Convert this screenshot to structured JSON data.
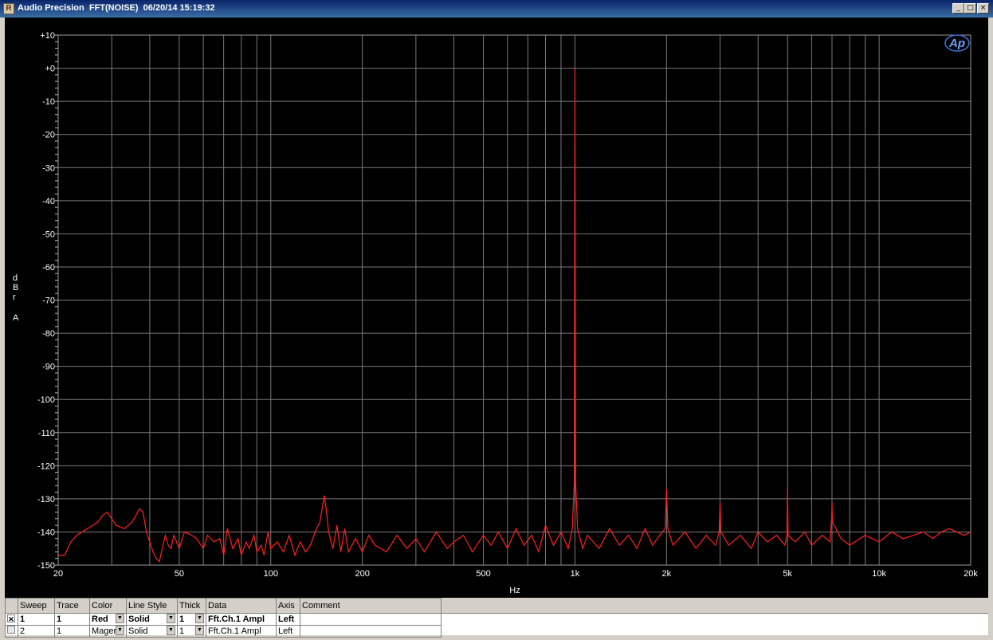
{
  "window": {
    "title": "Audio Precision  FFT(NOISE)  06/20/14 15:19:32",
    "icon": "ap-app-icon",
    "buttons": [
      "_",
      "□",
      "×"
    ]
  },
  "logo_text": "Ap",
  "chart_data": {
    "type": "line",
    "x_scale": "log",
    "xlim": [
      20,
      20000
    ],
    "ylim": [
      -150,
      10
    ],
    "xlabel": "Hz",
    "ylabel": "dBr A",
    "grid": true,
    "x_tick_labels": [
      "20",
      "50",
      "100",
      "200",
      "500",
      "1k",
      "2k",
      "5k",
      "10k",
      "20k"
    ],
    "x_ticks": [
      20,
      50,
      100,
      200,
      500,
      1000,
      2000,
      5000,
      10000,
      20000
    ],
    "y_ticks": [
      10,
      0,
      -10,
      -20,
      -30,
      -40,
      -50,
      -60,
      -70,
      -80,
      -90,
      -100,
      -110,
      -120,
      -130,
      -140,
      -150
    ],
    "y_tick_labels": [
      "+10",
      "+0",
      "-10",
      "-20",
      "-30",
      "-40",
      "-50",
      "-60",
      "-70",
      "-80",
      "-90",
      "-100",
      "-110",
      "-120",
      "-130",
      "-140",
      "-150"
    ],
    "background": "#000000",
    "grid_color": "#7a7a7a",
    "series": [
      {
        "color": "#ff2020",
        "x": [
          20,
          21,
          22,
          23,
          25,
          27,
          28,
          29,
          30,
          31,
          33,
          35,
          37,
          38,
          39,
          40,
          41,
          42,
          43,
          45,
          46,
          47,
          48,
          50,
          52,
          55,
          57,
          60,
          62,
          65,
          68,
          70,
          72,
          75,
          78,
          80,
          83,
          85,
          88,
          90,
          93,
          95,
          98,
          100,
          105,
          110,
          115,
          120,
          125,
          130,
          135,
          140,
          145,
          148,
          150,
          152,
          155,
          160,
          165,
          170,
          175,
          180,
          190,
          200,
          210,
          220,
          240,
          260,
          280,
          300,
          320,
          350,
          380,
          400,
          430,
          460,
          500,
          530,
          560,
          600,
          640,
          680,
          720,
          760,
          800,
          850,
          900,
          950,
          980,
          995,
          1000,
          1005,
          1020,
          1060,
          1100,
          1200,
          1300,
          1400,
          1500,
          1600,
          1700,
          1800,
          1900,
          1980,
          2000,
          2020,
          2100,
          2300,
          2500,
          2700,
          2900,
          2980,
          3000,
          3020,
          3200,
          3500,
          3800,
          4000,
          4300,
          4600,
          4900,
          4980,
          5000,
          5020,
          5300,
          5700,
          6000,
          6500,
          6900,
          6980,
          7000,
          7020,
          7500,
          8000,
          9000,
          10000,
          11000,
          12000,
          13000,
          14000,
          15000,
          16000,
          17000,
          18000,
          19000,
          20000
        ],
        "y": [
          -147,
          -147,
          -143,
          -141,
          -139,
          -137,
          -135,
          -134,
          -136,
          -138,
          -139,
          -137,
          -133,
          -134,
          -140,
          -143,
          -146,
          -148,
          -149,
          -141,
          -144,
          -145,
          -141,
          -145,
          -140,
          -141,
          -142,
          -145,
          -141,
          -143,
          -142,
          -147,
          -139,
          -145,
          -142,
          -147,
          -143,
          -145,
          -141,
          -146,
          -144,
          -147,
          -140,
          -145,
          -143,
          -146,
          -141,
          -147,
          -143,
          -146,
          -144,
          -140,
          -137,
          -132,
          -129,
          -133,
          -140,
          -145,
          -138,
          -146,
          -139,
          -146,
          -142,
          -146,
          -141,
          -144,
          -146,
          -141,
          -145,
          -142,
          -146,
          -140,
          -145,
          -143,
          -141,
          -146,
          -141,
          -144,
          -140,
          -145,
          -139,
          -144,
          -141,
          -146,
          -138,
          -144,
          -140,
          -145,
          -139,
          -125,
          0,
          -125,
          -139,
          -145,
          -141,
          -145,
          -139,
          -144,
          -141,
          -145,
          -139,
          -144,
          -141,
          -139,
          -127,
          -139,
          -144,
          -140,
          -145,
          -141,
          -144,
          -140,
          -131,
          -140,
          -144,
          -141,
          -145,
          -140,
          -143,
          -141,
          -144,
          -141,
          -127,
          -141,
          -143,
          -140,
          -144,
          -141,
          -143,
          -136,
          -131,
          -137,
          -142,
          -144,
          -141,
          -143,
          -140,
          -142,
          -141,
          -140,
          -142,
          -140,
          -139,
          -140,
          -141,
          -140
        ]
      }
    ]
  },
  "legend": {
    "columns": [
      "Sweep",
      "Trace",
      "Color",
      "Line Style",
      "Thick",
      "Data",
      "Axis",
      "Comment"
    ],
    "rows": [
      {
        "checked": true,
        "sweep": "1",
        "trace": "1",
        "color": "Red",
        "style": "Solid",
        "thick": "1",
        "data": "Fft.Ch.1 Ampl",
        "axis": "Left",
        "comment": ""
      },
      {
        "checked": false,
        "sweep": "2",
        "trace": "1",
        "color": "Mager",
        "style": "Solid",
        "thick": "1",
        "data": "Fft.Ch.1 Ampl",
        "axis": "Left",
        "comment": ""
      }
    ]
  }
}
